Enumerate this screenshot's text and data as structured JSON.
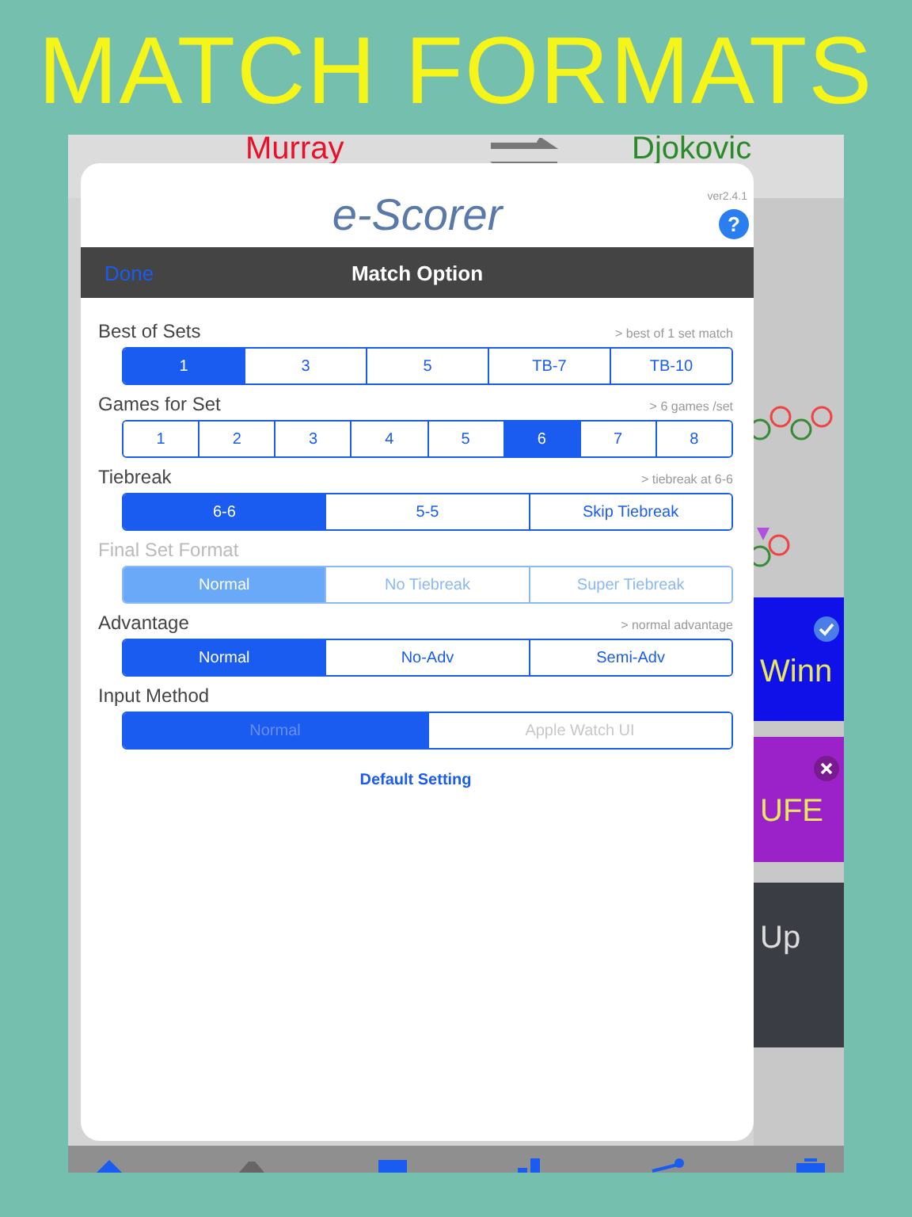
{
  "headline": "MATCH FORMATS",
  "background_app": {
    "player_1": "Murray",
    "player_2": "Djokovic",
    "buttons": [
      {
        "label": "Winn",
        "kind": "winner"
      },
      {
        "label": "UFE",
        "kind": "error"
      },
      {
        "label": "Up",
        "kind": "undo"
      }
    ]
  },
  "popover": {
    "title": "e-Scorer",
    "version": "ver2.4.1",
    "help": "?",
    "nav": {
      "left": "Done",
      "title": "Match Option"
    },
    "sections": [
      {
        "label": "Best of Sets",
        "hint": "> best of 1 set match",
        "disabled": false,
        "locked": false,
        "options": [
          {
            "label": "1",
            "selected": true
          },
          {
            "label": "3",
            "selected": false
          },
          {
            "label": "5",
            "selected": false
          },
          {
            "label": "TB-7",
            "selected": false
          },
          {
            "label": "TB-10",
            "selected": false
          }
        ]
      },
      {
        "label": "Games for Set",
        "hint": "> 6 games /set",
        "disabled": false,
        "locked": false,
        "options": [
          {
            "label": "1",
            "selected": false
          },
          {
            "label": "2",
            "selected": false
          },
          {
            "label": "3",
            "selected": false
          },
          {
            "label": "4",
            "selected": false
          },
          {
            "label": "5",
            "selected": false
          },
          {
            "label": "6",
            "selected": true
          },
          {
            "label": "7",
            "selected": false
          },
          {
            "label": "8",
            "selected": false
          }
        ]
      },
      {
        "label": "Tiebreak",
        "hint": "> tiebreak at 6-6",
        "disabled": false,
        "locked": false,
        "options": [
          {
            "label": "6-6",
            "selected": true
          },
          {
            "label": "5-5",
            "selected": false
          },
          {
            "label": "Skip Tiebreak",
            "selected": false
          }
        ]
      },
      {
        "label": "Final Set Format",
        "disabled": true,
        "locked": false,
        "options": [
          {
            "label": "Normal",
            "selected": true
          },
          {
            "label": "No Tiebreak",
            "selected": false
          },
          {
            "label": "Super Tiebreak",
            "selected": false
          }
        ]
      },
      {
        "label": "Advantage",
        "hint": "> normal advantage",
        "disabled": false,
        "locked": false,
        "options": [
          {
            "label": "Normal",
            "selected": true
          },
          {
            "label": "No-Adv",
            "selected": false
          },
          {
            "label": "Semi-Adv",
            "selected": false
          }
        ]
      },
      {
        "label": "Input Method",
        "disabled": false,
        "locked": true,
        "options": [
          {
            "label": "Normal",
            "selected": true
          },
          {
            "label": "Apple Watch UI",
            "selected": false
          }
        ]
      }
    ],
    "default_button": "Default Setting"
  }
}
